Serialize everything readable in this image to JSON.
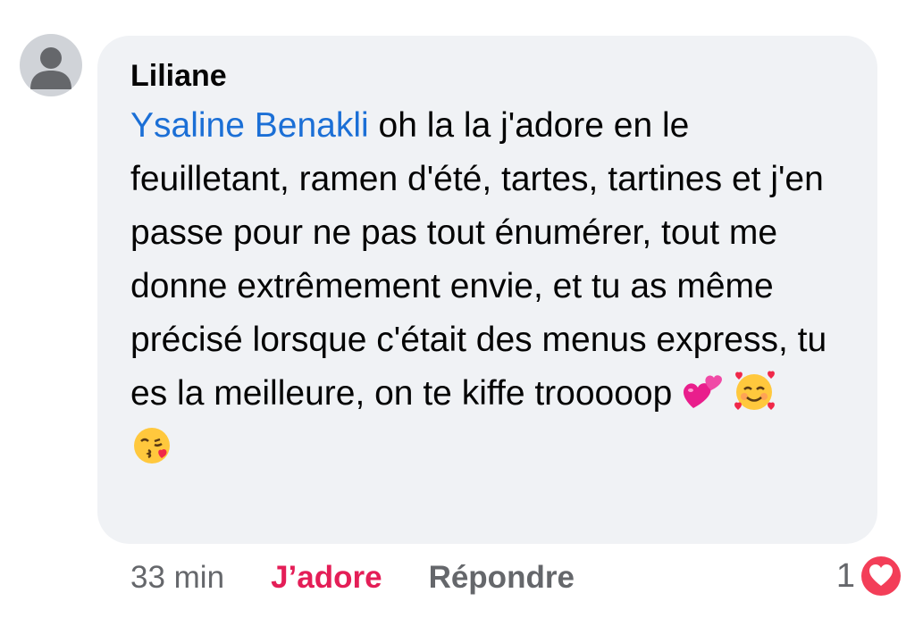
{
  "comment": {
    "author": "Liliane",
    "mention": "Ysaline Benakli",
    "text": " oh la la j'adore en le feuilletant, ramen d'été, tartes, tartines et j'en passe pour ne pas tout énumérer, tout me donne extrêmement envie, et tu as même précisé lorsque c'était des menus express, tu es la meilleure, on te kiffe trooooop ",
    "emojis": [
      "two-hearts-emoji",
      "smiling-face-with-hearts-emoji",
      "face-blowing-kiss-emoji"
    ]
  },
  "actions": {
    "time": "33 min",
    "like_label": "J’adore",
    "reply_label": "Répondre"
  },
  "reactions": {
    "count": "1",
    "type": "love-reaction-icon"
  },
  "colors": {
    "bubble_bg": "#f0f2f5",
    "mention": "#1b6fd6",
    "like_active": "#e41e57",
    "muted": "#65676b",
    "love_reaction": "#f33e58"
  }
}
